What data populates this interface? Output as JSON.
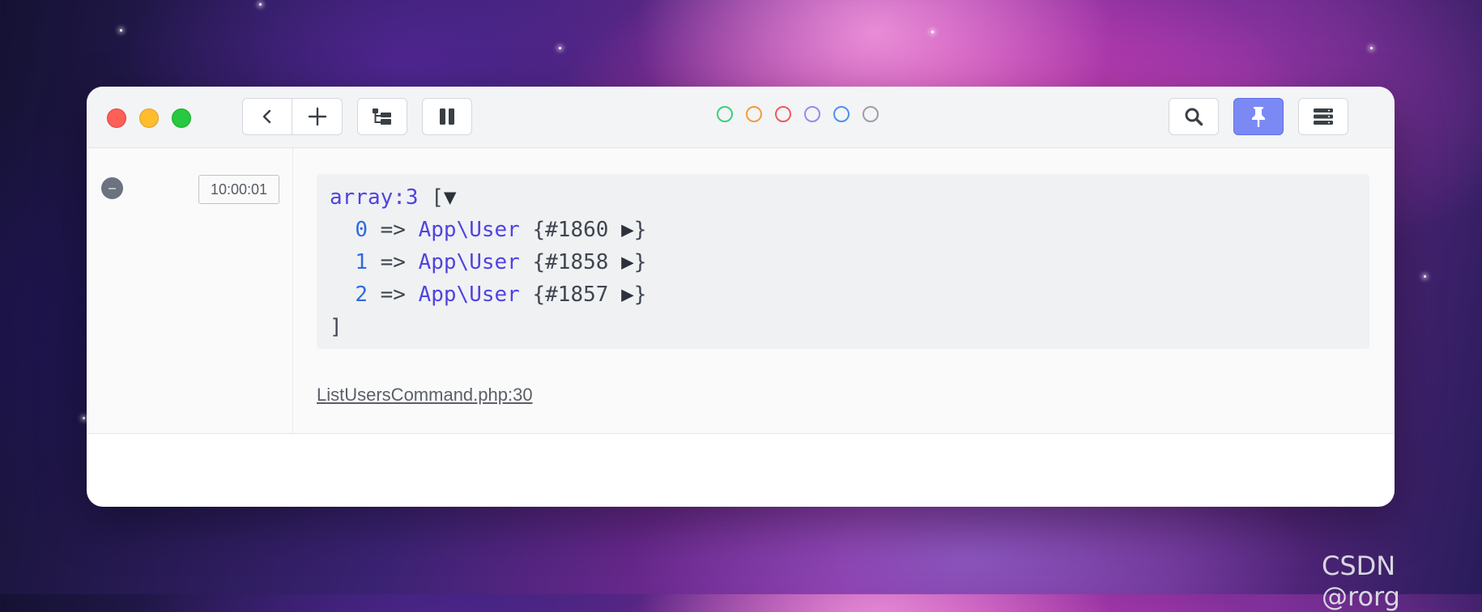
{
  "toolbar": {
    "nav_back_icon": "chevron-left-icon",
    "add_icon": "plus-icon",
    "tree_icon": "tree-structure-icon",
    "pause_icon": "pause-icon",
    "search_icon": "search-icon",
    "pin_icon": "pin-icon",
    "menu_icon": "server-stack-icon",
    "color_filters": [
      "#3ccf7a",
      "#f59a3c",
      "#ef5a5a",
      "#9a86f0",
      "#4a90f5",
      "#9aa0a8"
    ]
  },
  "entry": {
    "timestamp": "10:00:01",
    "dump": {
      "header_type": "array:3",
      "header_open": " [",
      "header_toggle": "▼",
      "items": [
        {
          "index": "0",
          "arrow": " => ",
          "class": "App\\User",
          "open": " {",
          "ref": "#1860",
          "toggle": " ▶",
          "close": "}"
        },
        {
          "index": "1",
          "arrow": " => ",
          "class": "App\\User",
          "open": " {",
          "ref": "#1858",
          "toggle": " ▶",
          "close": "}"
        },
        {
          "index": "2",
          "arrow": " => ",
          "class": "App\\User",
          "open": " {",
          "ref": "#1857",
          "toggle": " ▶",
          "close": "}"
        }
      ],
      "footer_close": "]"
    },
    "source_link": "ListUsersCommand.php:30"
  },
  "watermark": "CSDN @rorg"
}
